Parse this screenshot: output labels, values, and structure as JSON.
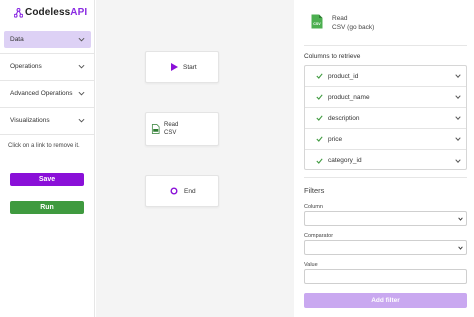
{
  "app": {
    "logo_text_dark": "Codeless",
    "logo_text_accent": "API",
    "brand_color": "#8a10d8"
  },
  "sidebar": {
    "items": [
      {
        "label": "Data",
        "icon": "chevron-down-icon"
      },
      {
        "label": "Operations",
        "icon": "chevron-down-icon"
      },
      {
        "label": "Advanced Operations",
        "icon": "chevron-down-icon"
      },
      {
        "label": "Visualizations",
        "icon": "chevron-down-icon"
      }
    ],
    "hint": "Click on a link to remove it.",
    "save_label": "Save",
    "run_label": "Run"
  },
  "canvas": {
    "start_label": "Start",
    "read_line1": "Read",
    "read_line2": "CSV",
    "end_label": "End"
  },
  "panel": {
    "file_line1": "Read",
    "file_line2": "CSV (go back)",
    "columns_label": "Columns to retrieve",
    "columns": [
      {
        "name": "product_id"
      },
      {
        "name": "product_name"
      },
      {
        "name": "description"
      },
      {
        "name": "price"
      },
      {
        "name": "category_id"
      }
    ],
    "filters_title": "Filters",
    "column_label": "Column",
    "column_value": "",
    "comparator_label": "Comparator",
    "comparator_value": "",
    "value_label": "Value",
    "value_value": "",
    "add_filter_label": "Add filter"
  }
}
